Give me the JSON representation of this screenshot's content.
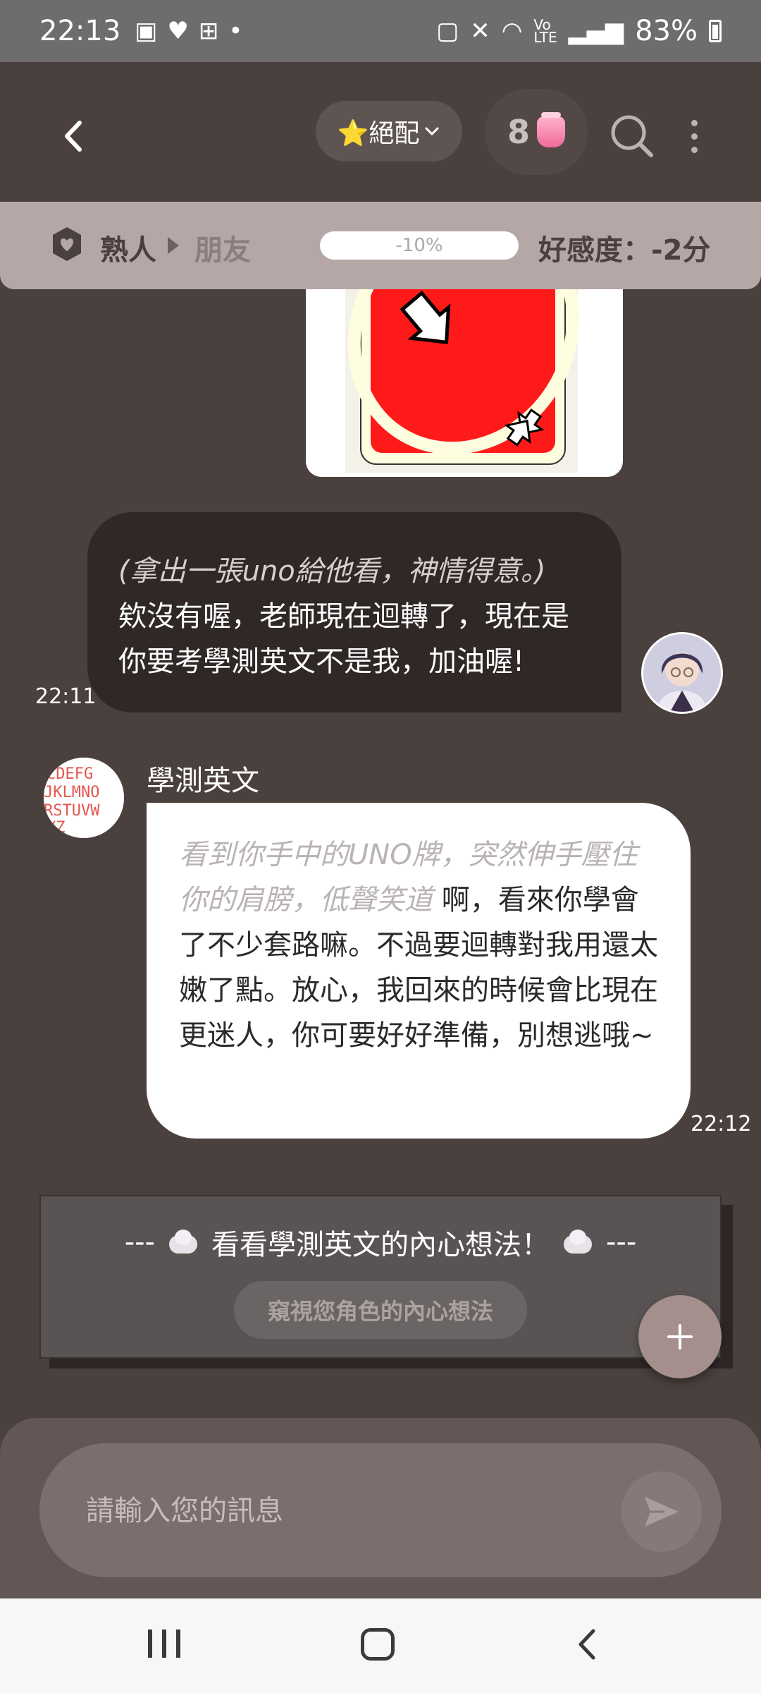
{
  "status_bar": {
    "time": "22:13",
    "battery": "83%"
  },
  "app_bar": {
    "match_label": "⭐絕配",
    "count": "8"
  },
  "affinity": {
    "current_level": "熟人",
    "next_level": "朋友",
    "progress": "-10%",
    "score": "好感度：-2分"
  },
  "messages": [
    {
      "sender": "me",
      "action": "(拿出一張uno給他看，神情得意。)",
      "text": "欸沒有喔，老師現在迴轉了，現在是你要考學測英文不是我，加油喔!",
      "time": "22:11"
    },
    {
      "sender": "bot",
      "name": "學測英文",
      "action": "看到你手中的UNO牌，突然伸手壓住你的肩膀，低聲笑道",
      "text": " 啊，看來你學會了不少套路嘛。不過要迴轉對我用還太嫩了點。放心，我回來的時候會比現在更迷人，你可要好好準備，別想逃哦~",
      "time": "22:12"
    }
  ],
  "thought_panel": {
    "title": "--- 💭 看看學測英文的內心想法！💭 ---",
    "prefix": "---",
    "text": "看看學測英文的內心想法！",
    "suffix": "---",
    "button": "窺視您角色的內心想法"
  },
  "composer": {
    "placeholder": "請輸入您的訊息"
  },
  "colors": {
    "background": "#4a403d",
    "affinity_bar": "#b5a7a6",
    "uno_red": "#ff1a1a",
    "fab": "#a48f8d"
  }
}
